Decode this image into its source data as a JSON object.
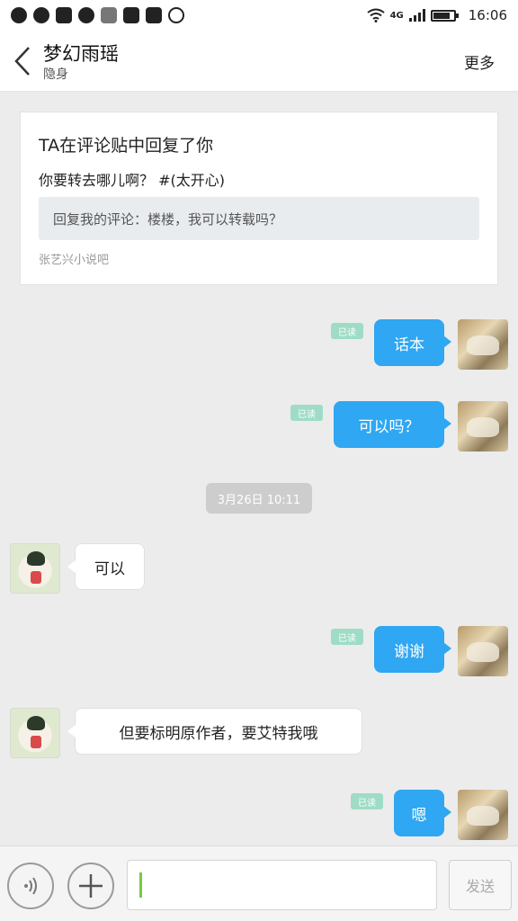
{
  "status_bar": {
    "network": "4G",
    "time": "16:06"
  },
  "nav": {
    "title": "梦幻雨瑶",
    "subtitle": "隐身",
    "more": "更多"
  },
  "notification": {
    "title": "TA在评论贴中回复了你",
    "reply": "你要转去哪儿啊？ #(太开心)",
    "quote": "回复我的评论：楼楼，我可以转载吗？",
    "source": "张艺兴小说吧"
  },
  "messages": [
    {
      "side": "out",
      "text": "话本",
      "read": "已读"
    },
    {
      "side": "out",
      "text": "可以吗？",
      "read": "已读"
    },
    {
      "side": "in",
      "text": "可以"
    },
    {
      "side": "out",
      "text": "谢谢",
      "read": "已读"
    },
    {
      "side": "in",
      "text": "但要标明原作者，要艾特我哦"
    },
    {
      "side": "out",
      "text": "嗯",
      "read": "已读"
    }
  ],
  "time_divider": "3月26日 10:11",
  "input": {
    "value": "",
    "send": "发送"
  },
  "colors": {
    "bubble_out": "#2fa7f2",
    "read_tag": "#9fdcc6",
    "caret": "#7ac943"
  }
}
